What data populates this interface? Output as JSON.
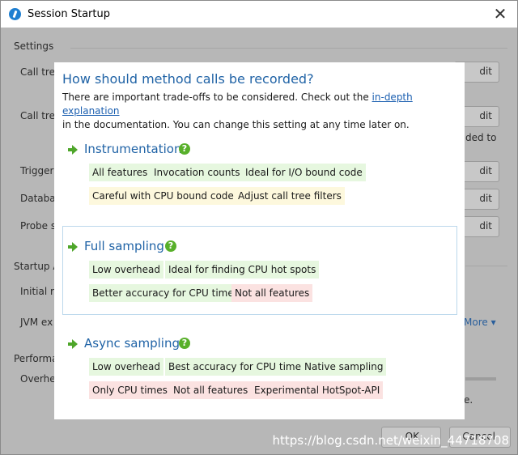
{
  "window": {
    "title": "Session Startup",
    "close_glyph": "✕"
  },
  "background": {
    "settings_label": "Settings",
    "labels": [
      "Call tre",
      "Call tre",
      "Trigger",
      "Databa",
      "Probe s",
      "Startup A",
      "Initial re",
      "JVM ex",
      "Performa",
      "Overhe"
    ],
    "buttons": [
      "dit",
      "dit",
      "dit",
      "dit",
      "dit",
      "OK",
      "Cancel"
    ],
    "side_text": "ded to",
    "more_link": "More",
    "trailing_text": "e."
  },
  "dialog": {
    "question": "How should method calls be recorded?",
    "desc_before": "There are important trade-offs to be considered. Check out the ",
    "desc_link": "in-depth explanation",
    "desc_after": "in the documentation. You can change this setting at any time later on.",
    "sections": [
      {
        "title": "Instrumentation",
        "selected": false,
        "rows": [
          [
            {
              "text": "All features",
              "type": "green"
            },
            {
              "text": "Invocation counts",
              "type": "green"
            },
            {
              "text": "Ideal for I/O bound code",
              "type": "green"
            }
          ],
          [
            {
              "text": "Careful with CPU bound code",
              "type": "yellow"
            },
            {
              "text": "Adjust call tree filters",
              "type": "yellow"
            }
          ]
        ]
      },
      {
        "title": "Full sampling",
        "selected": true,
        "rows": [
          [
            {
              "text": "Low overhead",
              "type": "green"
            },
            {
              "text": "Ideal for finding CPU hot spots",
              "type": "green"
            }
          ],
          [
            {
              "text": "Better accuracy for CPU times",
              "type": "green"
            },
            {
              "text": "Not all features",
              "type": "red"
            }
          ]
        ]
      },
      {
        "title": "Async sampling",
        "selected": false,
        "rows": [
          [
            {
              "text": "Low overhead",
              "type": "green"
            },
            {
              "text": "Best accuracy for CPU times",
              "type": "green"
            },
            {
              "text": "Native sampling",
              "type": "green"
            }
          ],
          [
            {
              "text": "Only CPU times",
              "type": "red"
            },
            {
              "text": "Not all features",
              "type": "red"
            },
            {
              "text": "Experimental HotSpot-API",
              "type": "red"
            }
          ]
        ]
      }
    ],
    "help_glyph": "?"
  },
  "watermark": "https://blog.csdn.net/weixin_44718708",
  "colors": {
    "accent": "#2063a6",
    "arrow_green": "#4ea62a",
    "tag_green": "#e6f7df",
    "tag_yellow": "#fdf8dd",
    "tag_red": "#fbe2e1",
    "overlay": "#b7b7b7"
  }
}
